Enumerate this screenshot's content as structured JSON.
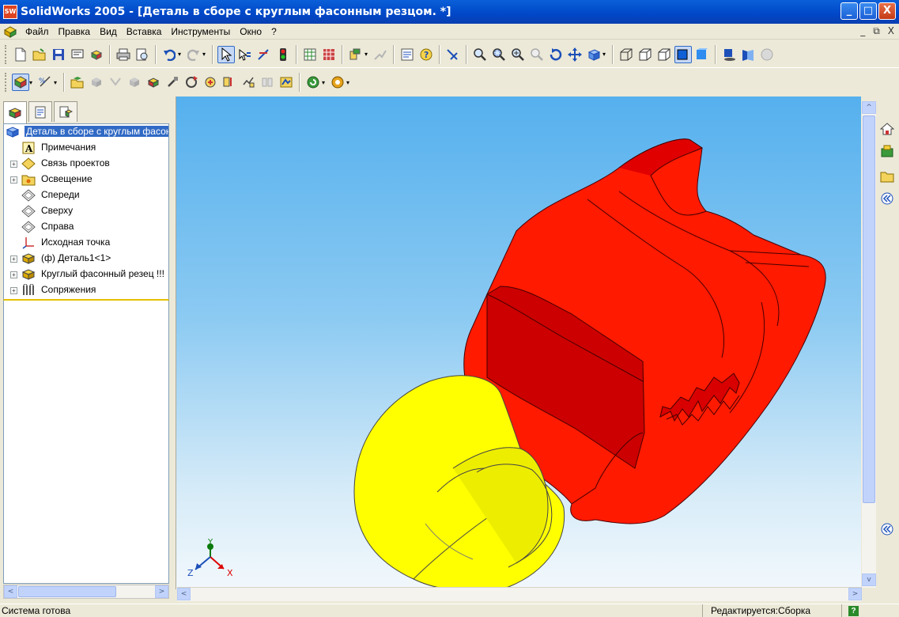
{
  "window": {
    "title": "SolidWorks 2005 - [Деталь в сборе с круглым фасонным резцом. *]",
    "app_icon_text": "SW",
    "buttons": {
      "minimize": "_",
      "maximize": "□",
      "close": "X"
    }
  },
  "menu": {
    "items": [
      "Файл",
      "Правка",
      "Вид",
      "Вставка",
      "Инструменты",
      "Окно",
      "?"
    ],
    "mdi_buttons": [
      "_",
      "⧉",
      "X"
    ]
  },
  "toolbar_top": {
    "icons": [
      "new-file-icon",
      "open-file-icon",
      "save-icon",
      "print-drawing-icon",
      "options-icon",
      "print-icon",
      "print-preview-icon",
      "undo-icon",
      "redo-icon",
      "select-icon",
      "select-other-icon",
      "sketch-icon",
      "traffic-light-icon",
      "grid-icon",
      "rebuild-icon",
      "layout-icon",
      "disabled-icon",
      "properties-icon",
      "help-icon",
      "smart-dimension-icon",
      "zoom-to-fit-icon",
      "zoom-window-icon",
      "zoom-in-out-icon",
      "zoom-selection-icon",
      "rotate-view-icon",
      "pan-icon",
      "standard-views-icon",
      "wireframe-icon",
      "hidden-lines-visible-icon",
      "hidden-lines-removed-icon",
      "shaded-with-edges-icon",
      "shaded-icon",
      "shadows-icon",
      "perspective-icon",
      "realview-icon"
    ]
  },
  "toolbar_second": {
    "icons": [
      "assembly-icon",
      "mate-options-icon",
      "insert-component-icon",
      "hide-show-icon",
      "change-transparency-icon",
      "edit-component-icon",
      "mate-icon",
      "move-component-icon",
      "rotate-component-icon",
      "smart-fasteners-icon",
      "explode-icon",
      "explode-line-icon",
      "interference-check-icon",
      "assembly-features-icon",
      "simulation-icon"
    ]
  },
  "feature_tree": {
    "tabs": [
      "feature-manager-tab",
      "property-manager-tab",
      "configuration-manager-tab"
    ],
    "root_label": "Деталь в сборе с круглым фасонным резцом.",
    "items": [
      {
        "label": "Примечания",
        "expand": ""
      },
      {
        "label": "Связь проектов",
        "expand": "+"
      },
      {
        "label": "Освещение",
        "expand": "+"
      },
      {
        "label": "Спереди",
        "expand": ""
      },
      {
        "label": "Сверху",
        "expand": ""
      },
      {
        "label": "Справа",
        "expand": ""
      },
      {
        "label": "Исходная точка",
        "expand": ""
      },
      {
        "label": "(ф) Деталь1<1>",
        "expand": "+"
      },
      {
        "label": "Круглый фасонный резец !!!",
        "expand": "+"
      },
      {
        "label": "Сопряжения",
        "expand": "+"
      }
    ]
  },
  "viewport": {
    "model_colors": {
      "holder": "#ff1a00",
      "holder_dark": "#c00000",
      "cutter": "#ffff00",
      "cutter_shade": "#d8d800"
    },
    "triad": {
      "x_label": "X",
      "y_label": "Y",
      "z_label": "Z"
    }
  },
  "scrollbars": {
    "left_arrow": "<",
    "right_arrow": ">",
    "up_arrow": "^",
    "down_arrow": "v"
  },
  "task_pane": {
    "icons": [
      "home-icon",
      "design-library-icon",
      "file-explorer-icon",
      "collapse-icon",
      "expand-icon"
    ]
  },
  "status": {
    "message": "Система готова",
    "edit_mode": "Редактируется:Сборка",
    "help_icon": "?"
  }
}
